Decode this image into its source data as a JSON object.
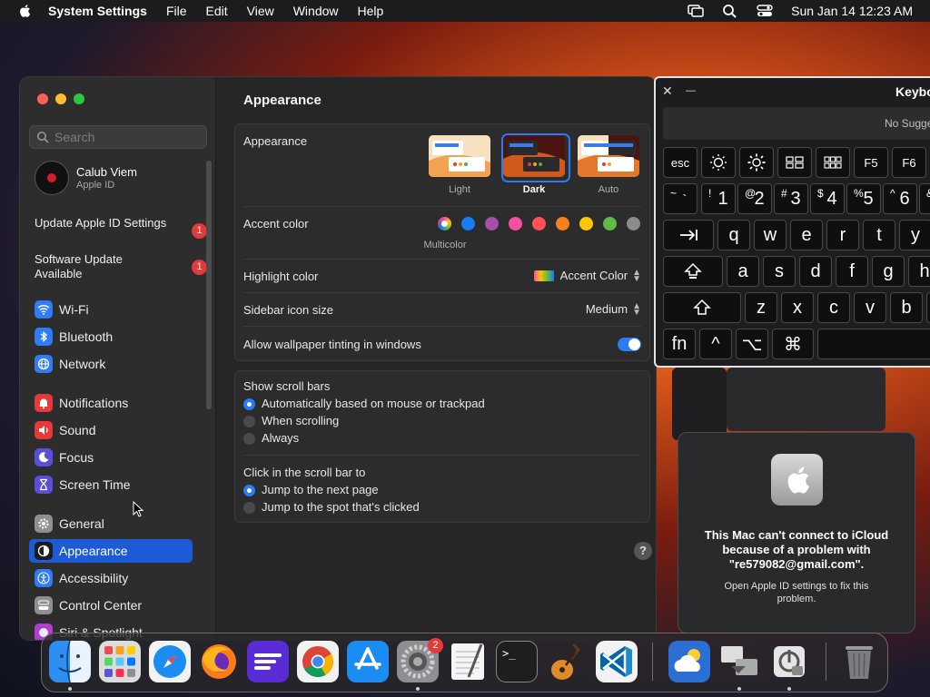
{
  "menubar": {
    "app_name": "System Settings",
    "menus": [
      "File",
      "Edit",
      "View",
      "Window",
      "Help"
    ],
    "datetime": "Sun Jan 14  12:23 AM"
  },
  "sidebar": {
    "search_placeholder": "Search",
    "user": {
      "name": "Calub Viem",
      "subtitle": "Apple ID"
    },
    "notices": [
      {
        "label": "Update Apple ID Settings",
        "badge": "1"
      },
      {
        "label": "Software Update Available",
        "badge": "1"
      }
    ],
    "items": [
      {
        "label": "Wi-Fi",
        "icon": "wifi-icon",
        "color": "#2f7cf6"
      },
      {
        "label": "Bluetooth",
        "icon": "bluetooth-icon",
        "color": "#2f7cf6"
      },
      {
        "label": "Network",
        "icon": "globe-icon",
        "color": "#2f7cf6"
      },
      {
        "label": "Notifications",
        "icon": "bell-icon",
        "color": "#e5393a"
      },
      {
        "label": "Sound",
        "icon": "speaker-icon",
        "color": "#e5393a"
      },
      {
        "label": "Focus",
        "icon": "moon-icon",
        "color": "#5b4fd8"
      },
      {
        "label": "Screen Time",
        "icon": "hourglass-icon",
        "color": "#5b4fd8"
      },
      {
        "label": "General",
        "icon": "gear-icon",
        "color": "#8e8e93"
      },
      {
        "label": "Appearance",
        "icon": "appearance-icon",
        "color": "#1c1c1e"
      },
      {
        "label": "Accessibility",
        "icon": "accessibility-icon",
        "color": "#2f7cf6"
      },
      {
        "label": "Control Center",
        "icon": "control-center-icon",
        "color": "#8e8e93"
      },
      {
        "label": "Siri & Spotlight",
        "icon": "siri-icon",
        "color": "#b03fd0"
      }
    ],
    "selected": "Appearance"
  },
  "content": {
    "title": "Appearance",
    "appearance": {
      "label": "Appearance",
      "options": [
        "Light",
        "Dark",
        "Auto"
      ],
      "selected": "Dark"
    },
    "accent": {
      "label": "Accent color",
      "colors": [
        "#cccccc",
        "#1a7cf5",
        "#a550a7",
        "#f74f9e",
        "#ff5257",
        "#f7821b",
        "#ffc600",
        "#62ba46",
        "#8c8c8c"
      ],
      "selected_name": "Multicolor"
    },
    "highlight": {
      "label": "Highlight color",
      "value": "Accent Color"
    },
    "sidebar_icon_size": {
      "label": "Sidebar icon size",
      "value": "Medium"
    },
    "wallpaper_tinting": {
      "label": "Allow wallpaper tinting in windows",
      "on": true
    },
    "scroll_bars": {
      "label": "Show scroll bars",
      "options": [
        "Automatically based on mouse or trackpad",
        "When scrolling",
        "Always"
      ],
      "selected_index": 0
    },
    "click_scroll": {
      "label": "Click in the scroll bar to",
      "options": [
        "Jump to the next page",
        "Jump to the spot that's clicked"
      ],
      "selected_index": 0
    },
    "help_label": "?"
  },
  "keyboard_viewer": {
    "title": "Keybo",
    "close": "✕",
    "minimize": "—",
    "suggestions": "No Sugge",
    "fn_row": [
      "esc",
      "F5",
      "F6"
    ],
    "number_row": [
      {
        "sup": "~",
        "main": "`"
      },
      {
        "sup": "!",
        "main": "1"
      },
      {
        "sup": "@",
        "main": "2"
      },
      {
        "sup": "#",
        "main": "3"
      },
      {
        "sup": "$",
        "main": "4"
      },
      {
        "sup": "%",
        "main": "5"
      },
      {
        "sup": "^",
        "main": "6"
      },
      {
        "sup": "&",
        "main": ""
      }
    ],
    "row_q": [
      "q",
      "w",
      "e",
      "r",
      "t",
      "y"
    ],
    "row_a": [
      "a",
      "s",
      "d",
      "f",
      "g",
      "h"
    ],
    "row_z": [
      "z",
      "x",
      "c",
      "v",
      "b"
    ],
    "bottom": [
      "fn",
      "^",
      "⌥",
      "⌘"
    ]
  },
  "alert": {
    "title": "This Mac can't connect to iCloud because of a problem with \"re579082@gmail.com\".",
    "message": "Open Apple ID settings to fix this problem."
  },
  "dock": {
    "apps": [
      "finder-icon",
      "launchpad-icon",
      "safari-icon",
      "firefox-icon",
      "fig-icon",
      "chrome-icon",
      "app-store-icon",
      "system-settings-icon",
      "textedit-icon",
      "terminal-icon",
      "garageband-icon",
      "vscode-icon",
      "icloud-weather-icon",
      "migration-icon",
      "disk-utility-icon",
      "trash-icon"
    ],
    "settings_badge": "2",
    "terminal_prompt": ">_"
  }
}
